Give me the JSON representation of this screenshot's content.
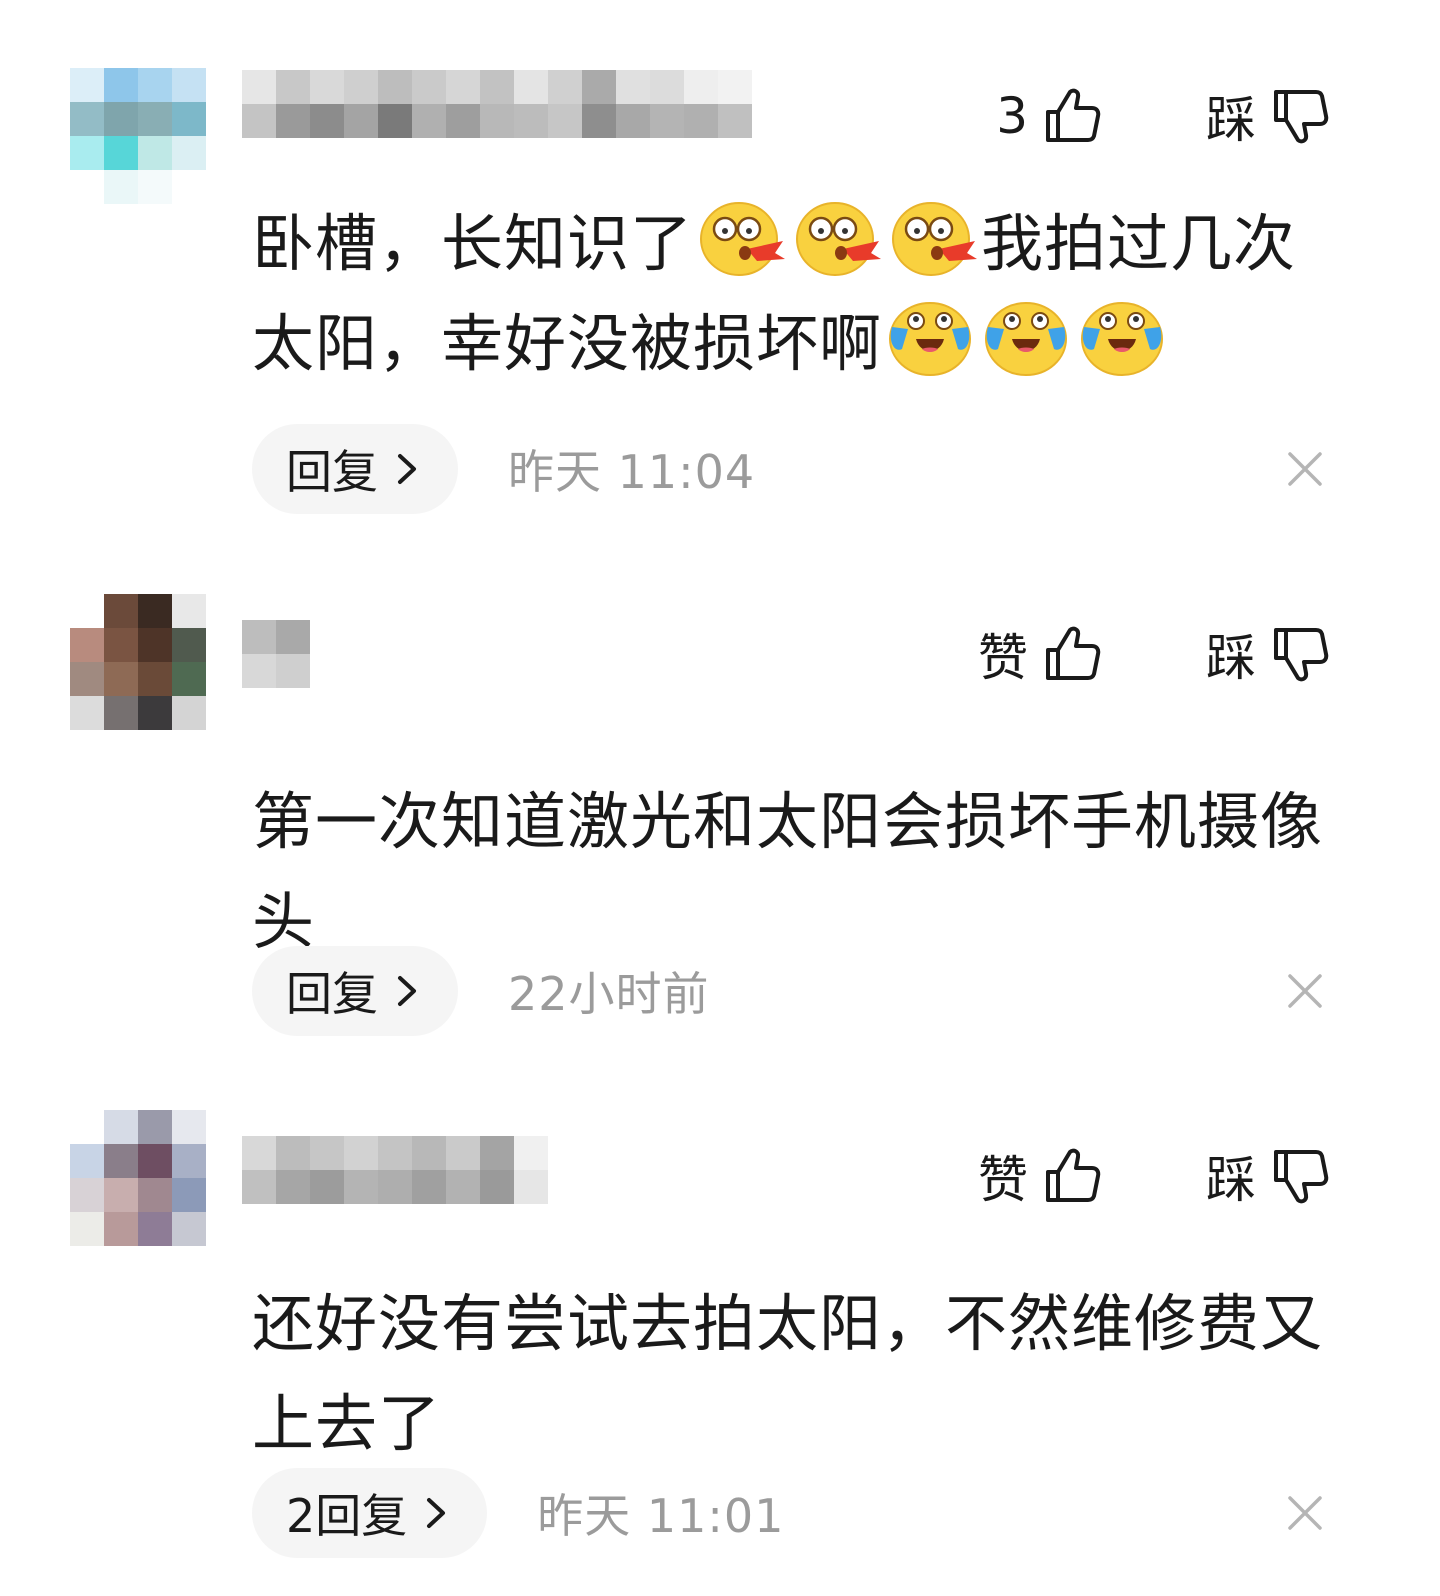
{
  "comments": [
    {
      "like_label": "3",
      "dislike_label": "踩",
      "text_parts": [
        "卧槽，长知识了",
        "我拍过几次太阳，幸好没被损坏啊"
      ],
      "reply_label": "回复",
      "time": "昨天  11:04"
    },
    {
      "like_label": "赞",
      "dislike_label": "踩",
      "text": "第一次知道激光和太阳会损坏手机摄像头",
      "reply_label": "回复",
      "time": "22小时前"
    },
    {
      "like_label": "赞",
      "dislike_label": "踩",
      "text": "还好没有尝试去拍太阳，不然维修费又上去了",
      "reply_label": "2回复",
      "time": "昨天  11:01"
    }
  ],
  "icons": {
    "like": "thumbs-up-icon",
    "dislike": "thumbs-down-icon",
    "reply_more": "chevron-right-icon",
    "close": "close-icon",
    "emoji_a": "shocked-spitting-emoji",
    "emoji_b": "crying-laughing-emoji"
  },
  "colors": {
    "text": "#1a1a1a",
    "muted": "#9b9b9b",
    "reply_bg": "#f5f5f5",
    "close": "#b5b5b5"
  }
}
